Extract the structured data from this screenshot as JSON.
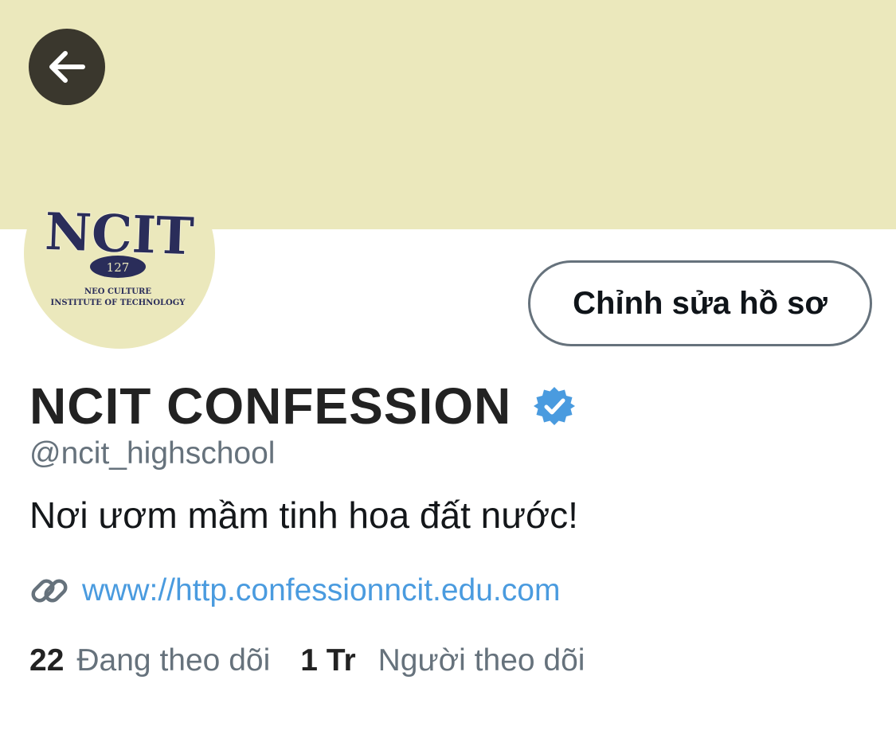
{
  "profile": {
    "back_icon": "arrow-left-icon",
    "avatar": {
      "logo_text": "NCIT",
      "logo_number": "127",
      "logo_line1": "NEO CULTURE",
      "logo_line2": "INSTITUTE OF TECHNOLOGY"
    },
    "edit_button_label": "Chỉnh sửa hồ sơ",
    "display_name": "NCIT CONFESSION",
    "verified_icon": "verified-badge-icon",
    "handle": "@ncit_highschool",
    "bio": "Nơi ươm mầm tinh hoa đất nước!",
    "link_icon": "link-icon",
    "website": "www://http.confessionncit.edu.com",
    "following_count": "22",
    "following_label": "Đang theo dõi",
    "followers_count": "1 Tr",
    "followers_label": "Người theo dõi"
  },
  "colors": {
    "banner": "#ebe8bc",
    "back_button": "#3a372d",
    "link": "#4a9bdf",
    "secondary_text": "#66727c",
    "verified": "#4a9bdf",
    "logo_navy": "#2a2d5a"
  }
}
